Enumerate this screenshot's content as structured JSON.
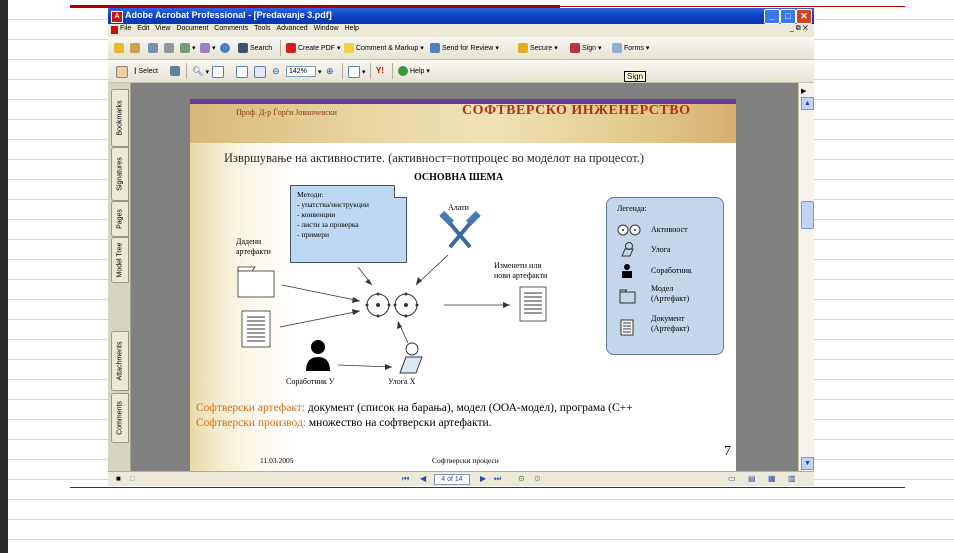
{
  "window": {
    "title": "Adobe Acrobat Professional - [Predavanje 3.pdf]",
    "controls": {
      "minimize": "_",
      "maximize": "□",
      "close": "✕"
    }
  },
  "menu": {
    "items": [
      "File",
      "Edit",
      "View",
      "Document",
      "Comments",
      "Tools",
      "Advanced",
      "Window",
      "Help"
    ],
    "mdi_controls": "_ ⧉ ✕"
  },
  "toolbar": {
    "search": "Search",
    "create_pdf": "Create PDF",
    "comment_markup": "Comment & Markup",
    "send_review": "Send for Review",
    "secure": "Secure",
    "sign": "Sign",
    "forms": "Forms",
    "select": "Select",
    "zoom": "142%",
    "help": "Help",
    "tooltip": "Sign"
  },
  "sidebar": {
    "tabs": [
      "Bookmarks",
      "Signatures",
      "Pages",
      "Model Tree",
      "Attachments",
      "Comments"
    ]
  },
  "slide": {
    "author": "Проф. Д-р Ѓорѓи Јованчевски",
    "course_title": "СОФТВЕРСКО ИНЖЕНЕРСТВО",
    "heading": "Извршување на активностите. (активност=потпроцес во моделот на процесот.)",
    "schema_title": "ОСНОВНА ШЕМА",
    "methods_lines": [
      "Методи:",
      "- упатства/инструкции",
      "- конвенции",
      "- листи за проверка",
      "- примери"
    ],
    "tools_label": "Алати",
    "given_artifacts": [
      "Дадени",
      "артефакти"
    ],
    "changed_artifacts": [
      "Изменети или",
      "нови артефакти"
    ],
    "collaborator_y": "Соработник У",
    "role_x": "Улога Х",
    "legend": {
      "title": "Легенда:",
      "activity": "Активност",
      "role": "Улога",
      "collaborator": "Соработник",
      "model": [
        "Модел",
        "(Артефакт)"
      ],
      "document": [
        "Документ",
        "(Артефакт)"
      ]
    },
    "line1_label": "Софтверски артефакт:",
    "line1_text": " документ (список на барања), модел (ООА-модел), програма (C++",
    "line2_label": "Софтверски производ:",
    "line2_text": " множество на софтверски артефакти.",
    "footer_date": "11.03.2005",
    "footer_course": "Софтверски процеси",
    "page_number": "7"
  },
  "status": {
    "page_field": "4 of 14"
  },
  "colors": {
    "title_bar": "#0a3dbf",
    "accent_red": "#b00000",
    "slide_title": "#b03010",
    "orange_label": "#d0701a",
    "methods_box": "#bcd8f2",
    "legend_box": "#c6d6ea"
  }
}
